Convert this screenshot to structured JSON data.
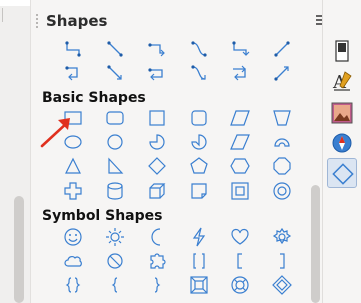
{
  "panel": {
    "title": "Shapes",
    "sections": [
      {
        "label": "Basic Shapes"
      },
      {
        "label": "Symbol Shapes"
      }
    ]
  },
  "icons": {
    "menu": "menu-icon",
    "close": "close-icon"
  },
  "colors": {
    "accent": "#3a7fd0",
    "arrow": "#e0301e"
  }
}
